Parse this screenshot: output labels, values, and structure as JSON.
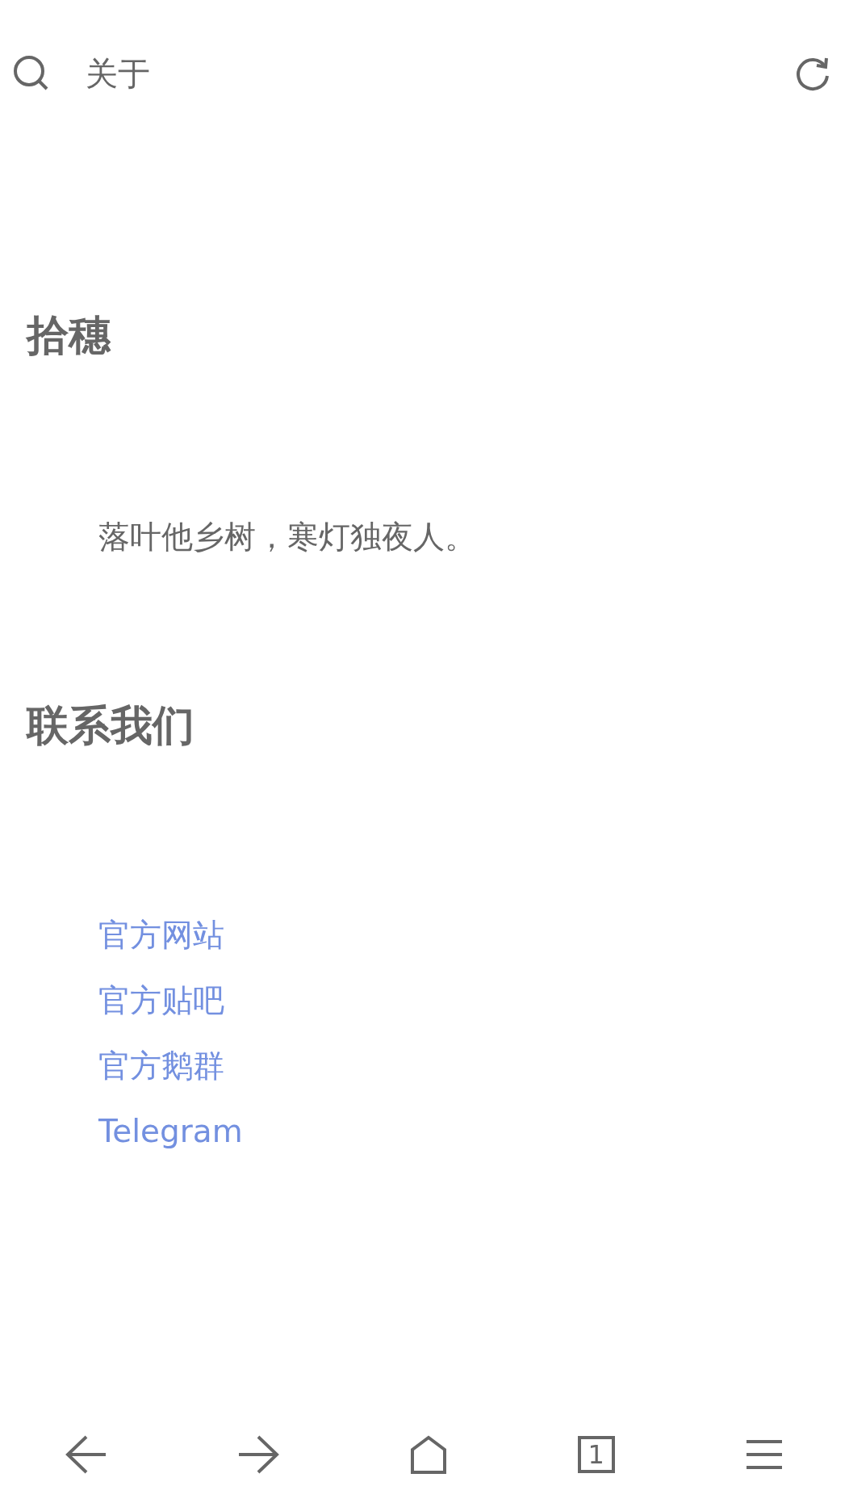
{
  "toolbar": {
    "title": "关于"
  },
  "sections": [
    {
      "heading": "拾穗",
      "kind": "text",
      "text": "落叶他乡树，寒灯独夜人。"
    },
    {
      "heading": "联系我们",
      "kind": "links",
      "links": [
        "官方网站",
        "官方贴吧",
        "官方鹅群",
        "Telegram"
      ]
    }
  ],
  "bottom_bar": {
    "tab_count": "1"
  }
}
